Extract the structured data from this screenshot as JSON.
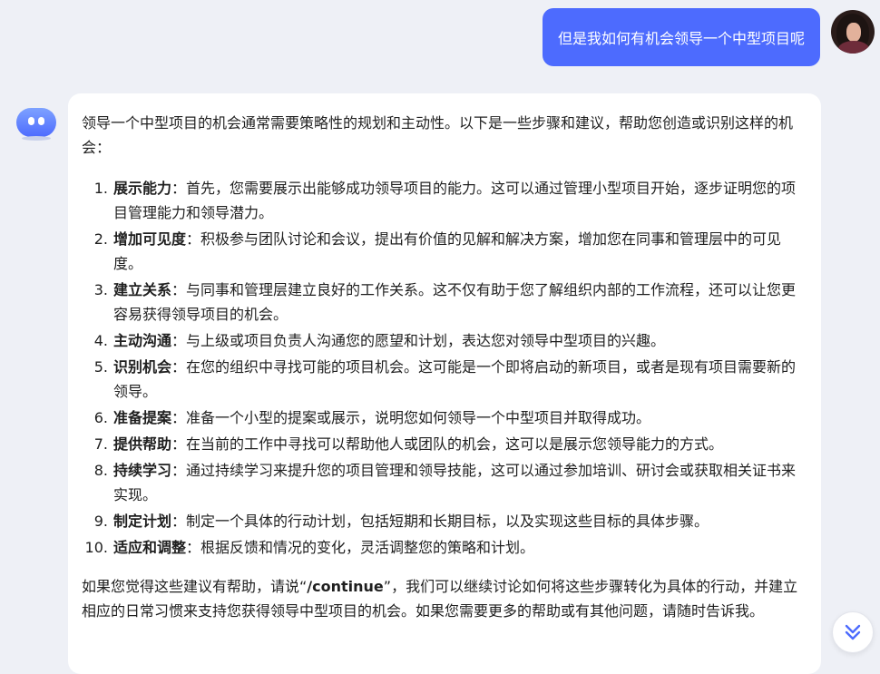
{
  "user_message": "但是我如何有机会领导一个中型项目呢",
  "assistant": {
    "intro": "领导一个中型项目的机会通常需要策略性的规划和主动性。以下是一些步骤和建议，帮助您创造或识别这样的机会：",
    "steps": [
      {
        "num": "1.",
        "title": "展示能力",
        "text": "：首先，您需要展示出能够成功领导项目的能力。这可以通过管理小型项目开始，逐步证明您的项目管理能力和领导潜力。"
      },
      {
        "num": "2.",
        "title": "增加可见度",
        "text": "：积极参与团队讨论和会议，提出有价值的见解和解决方案，增加您在同事和管理层中的可见度。"
      },
      {
        "num": "3.",
        "title": "建立关系",
        "text": "：与同事和管理层建立良好的工作关系。这不仅有助于您了解组织内部的工作流程，还可以让您更容易获得领导项目的机会。"
      },
      {
        "num": "4.",
        "title": "主动沟通",
        "text": "：与上级或项目负责人沟通您的愿望和计划，表达您对领导中型项目的兴趣。"
      },
      {
        "num": "5.",
        "title": "识别机会",
        "text": "：在您的组织中寻找可能的项目机会。这可能是一个即将启动的新项目，或者是现有项目需要新的领导。"
      },
      {
        "num": "6.",
        "title": "准备提案",
        "text": "：准备一个小型的提案或展示，说明您如何领导一个中型项目并取得成功。"
      },
      {
        "num": "7.",
        "title": "提供帮助",
        "text": "：在当前的工作中寻找可以帮助他人或团队的机会，这可以是展示您领导能力的方式。"
      },
      {
        "num": "8.",
        "title": "持续学习",
        "text": "：通过持续学习来提升您的项目管理和领导技能，这可以通过参加培训、研讨会或获取相关证书来实现。"
      },
      {
        "num": "9.",
        "title": "制定计划",
        "text": "：制定一个具体的行动计划，包括短期和长期目标，以及实现这些目标的具体步骤。"
      },
      {
        "num": "10.",
        "title": "适应和调整",
        "text": "：根据反馈和情况的变化，灵活调整您的策略和计划。"
      }
    ],
    "outro_before": "如果您觉得这些建议有帮助，请说“",
    "outro_cmd": "/continue",
    "outro_after": "”，我们可以继续讨论如何将这些步骤转化为具体的行动，并建立相应的日常习惯来支持您获得领导中型项目的机会。如果您需要更多的帮助或有其他问题，请随时告诉我。"
  },
  "icons": {
    "user_avatar": "user-avatar-photo",
    "bot_avatar": "bot-avatar-icon",
    "scroll_down": "double-chevron-down-icon"
  },
  "colors": {
    "accent": "#4d6bfe",
    "background": "#eef0f6",
    "bubble": "#ffffff"
  }
}
